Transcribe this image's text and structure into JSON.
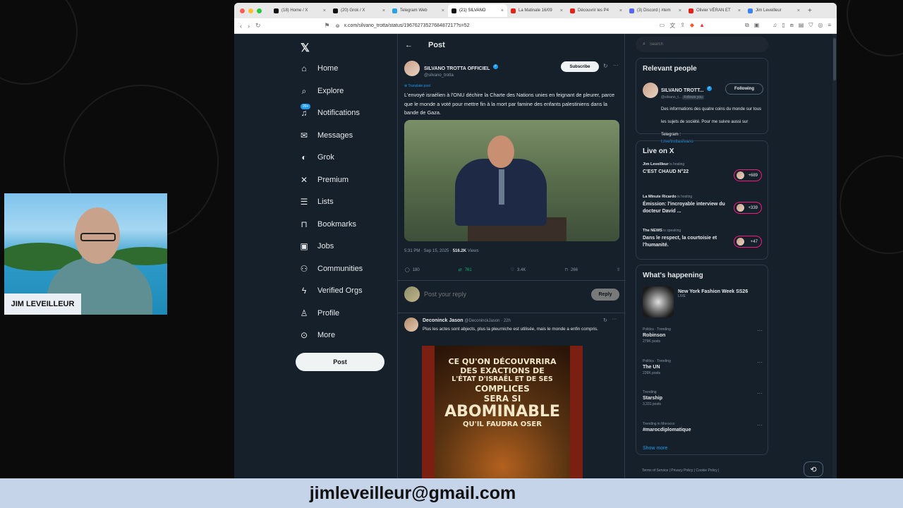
{
  "browser": {
    "tabs": [
      {
        "label": "(18) Home / X",
        "icon": "x-icon",
        "color": "#111111"
      },
      {
        "label": "(20) Grok / X",
        "icon": "x-icon",
        "color": "#111111"
      },
      {
        "label": "Telegram Web",
        "icon": "telegram-icon",
        "color": "#2aa3e0"
      },
      {
        "label": "(21) SILVANO",
        "icon": "x-icon",
        "color": "#111111",
        "active": true
      },
      {
        "label": "La Matinale 16/09",
        "icon": "youtube-icon",
        "color": "#e62117"
      },
      {
        "label": "Découvrir les P4",
        "icon": "youtube-icon",
        "color": "#e62117"
      },
      {
        "label": "(3) Discord | #tem",
        "icon": "discord-icon",
        "color": "#5865f2"
      },
      {
        "label": "Olivier VÉRAN ET",
        "icon": "youtube-icon",
        "color": "#e62117"
      },
      {
        "label": "Jim Leveilleur",
        "icon": "browser-icon",
        "color": "#3b82f6"
      }
    ],
    "url": "x.com/silvano_trotta/status/1967627352768487217?s=52"
  },
  "nav": {
    "items": [
      {
        "label": "Home",
        "icon": "home-icon"
      },
      {
        "label": "Explore",
        "icon": "search-icon"
      },
      {
        "label": "Notifications",
        "icon": "bell-icon",
        "badge": "20+"
      },
      {
        "label": "Messages",
        "icon": "mail-icon"
      },
      {
        "label": "Grok",
        "icon": "grok-icon"
      },
      {
        "label": "Premium",
        "icon": "x-icon"
      },
      {
        "label": "Lists",
        "icon": "list-icon"
      },
      {
        "label": "Bookmarks",
        "icon": "bookmark-icon"
      },
      {
        "label": "Jobs",
        "icon": "briefcase-icon"
      },
      {
        "label": "Communities",
        "icon": "people-icon"
      },
      {
        "label": "Verified Orgs",
        "icon": "lightning-icon"
      },
      {
        "label": "Profile",
        "icon": "person-icon"
      },
      {
        "label": "More",
        "icon": "more-icon"
      }
    ],
    "post_label": "Post"
  },
  "main": {
    "header_title": "Post",
    "author_name": "SILVANO TROTTA OFFICIEL",
    "author_handle": "@silvano_trotta",
    "subscribe_label": "Subscribe",
    "translate_label": "Translate post",
    "post_text": "L'envoyé israélien à l'ONU déchire la Charte des Nations unies en feignant de pleurer, parce que le monde a voté pour mettre fin à la mort par famine des enfants palestiniens dans la bande de Gaza.",
    "meta_time": "5:31 PM · Sep 15, 2025 · ",
    "meta_views": "516.2K",
    "meta_views_label": " Views",
    "actions": {
      "replies": "180",
      "reposts": "761",
      "likes": "3.4K",
      "bookmarks": "266"
    },
    "reply_placeholder": "Post your reply",
    "reply_button": "Reply",
    "reply": {
      "name": "Deconinck Jason",
      "handle": "@DeconinckJason · 22h",
      "text": "Plus les actes sont abjects, plus la pleurniche est utilisée, mais le monde a enfin compris.",
      "poster_lines": [
        "CE QU'ON DÉCOUVRRIRA",
        "DES EXACTIONS DE",
        "L'ÉTAT D'ISRAËL ET DE SES",
        "COMPLICES",
        "SERA SI",
        "ABOMINABLE",
        "QU'IL FAUDRA OSER"
      ]
    }
  },
  "right": {
    "search_placeholder": "Search",
    "relevant": {
      "title": "Relevant people",
      "name": "SILVANO TROTT...",
      "handle": "@silvano_t...",
      "follows_you": "Follows you",
      "following_label": "Following",
      "bio": "Des informations des quatre coins du monde sur tous les sujets de société. Pour me suivre aussi sur Telegram :",
      "bio_link": "t.me/trottasilvano"
    },
    "live": {
      "title": "Live on X",
      "items": [
        {
          "host": "Jim Leveilleur",
          "status": "is hosting",
          "title": "C'EST CHAUD N°22",
          "count": "+689"
        },
        {
          "host": "La Minute Ricardo",
          "status": "is hosting",
          "title": "Émission: l'incroyable interview du docteur David ...",
          "count": "+339"
        },
        {
          "host": "The NEWS",
          "status": "is speaking",
          "title": "Dans le respect, la courtoisie et l'humanité.",
          "count": "+47"
        }
      ]
    },
    "happening": {
      "title": "What's happening",
      "feature": {
        "title": "New York Fashion Week SS26",
        "sub": "LIVE"
      },
      "trends": [
        {
          "context": "Politics · Trending",
          "name": "Robinson",
          "posts": "279K posts"
        },
        {
          "context": "Politics · Trending",
          "name": "The UN",
          "posts": "226K posts"
        },
        {
          "context": "Trending",
          "name": "Starship",
          "posts": "3,331 posts"
        },
        {
          "context": "Trending in Morocco",
          "name": "#marocdiplomatique",
          "posts": ""
        }
      ],
      "show_more": "Show more"
    },
    "footer": "Terms of Service  |  Privacy Policy  |  Cookie Policy  |"
  },
  "webcam": {
    "label": "JIM LEVEILLEUR"
  },
  "banner": {
    "text": "jimleveilleur@gmail.com"
  },
  "colors": {
    "accent": "#1d9bf0",
    "background": "#15202b",
    "banner": "#c6d4ea",
    "live": "#f91880"
  }
}
